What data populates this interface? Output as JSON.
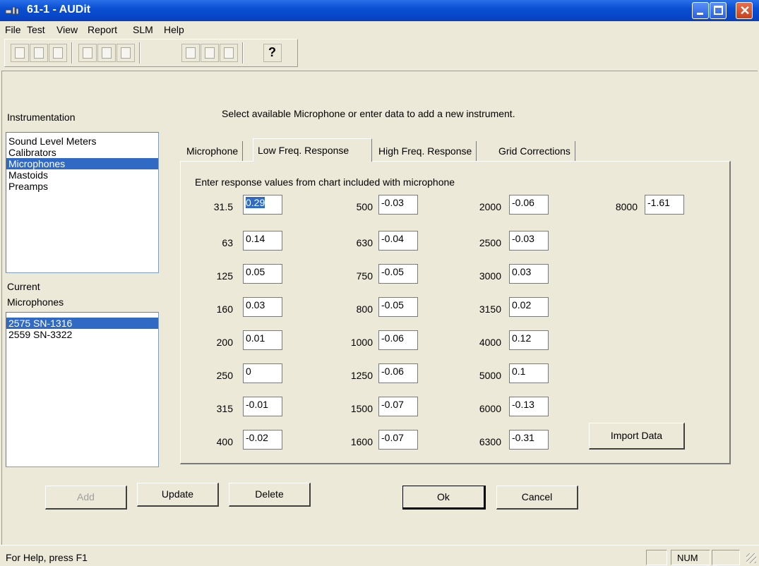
{
  "window": {
    "title": "61-1 - AUDit",
    "close_glyph": "✕"
  },
  "menu": [
    "File",
    "Test",
    "View",
    "Report",
    "SLM",
    "Help"
  ],
  "toolbar": {
    "icons": [
      "new-icon",
      "open-icon",
      "save-icon",
      "sound-level-meter-icon",
      "calibrator-icon",
      "microphone-icon",
      "report-icon",
      "report2-icon",
      "report3-icon",
      "help-icon"
    ],
    "help_glyph": "?"
  },
  "instrumentation": {
    "label": "Instrumentation",
    "items": [
      "Sound Level Meters",
      "Calibrators",
      "Microphones",
      "Mastoids",
      "Preamps"
    ],
    "selected_index": 2
  },
  "current": {
    "label_line1": "Current",
    "label_line2": "Microphones",
    "items": [
      "2575 SN-1316",
      "2559 SN-3322"
    ],
    "selected_index": 0
  },
  "instruction": "Select available Microphone or enter data to add a new instrument.",
  "tabs": [
    "Microphone",
    "Low Freq. Response",
    "High Freq. Response",
    "Grid Corrections"
  ],
  "active_tab": "Low Freq. Response",
  "panel": {
    "hint": "Enter response values from chart included with microphone",
    "columns": [
      [
        {
          "freq": "31.5",
          "value": "0.29"
        },
        {
          "freq": "63",
          "value": "0.14"
        },
        {
          "freq": "125",
          "value": "0.05"
        },
        {
          "freq": "160",
          "value": "0.03"
        },
        {
          "freq": "200",
          "value": "0.01"
        },
        {
          "freq": "250",
          "value": "0"
        },
        {
          "freq": "315",
          "value": "-0.01"
        },
        {
          "freq": "400",
          "value": "-0.02"
        }
      ],
      [
        {
          "freq": "500",
          "value": "-0.03"
        },
        {
          "freq": "630",
          "value": "-0.04"
        },
        {
          "freq": "750",
          "value": "-0.05"
        },
        {
          "freq": "800",
          "value": "-0.05"
        },
        {
          "freq": "1000",
          "value": "-0.06"
        },
        {
          "freq": "1250",
          "value": "-0.06"
        },
        {
          "freq": "1500",
          "value": "-0.07"
        },
        {
          "freq": "1600",
          "value": "-0.07"
        }
      ],
      [
        {
          "freq": "2000",
          "value": "-0.06"
        },
        {
          "freq": "2500",
          "value": "-0.03"
        },
        {
          "freq": "3000",
          "value": "0.03"
        },
        {
          "freq": "3150",
          "value": "0.02"
        },
        {
          "freq": "4000",
          "value": "0.12"
        },
        {
          "freq": "5000",
          "value": "0.1"
        },
        {
          "freq": "6000",
          "value": "-0.13"
        },
        {
          "freq": "6300",
          "value": "-0.31"
        }
      ],
      [
        {
          "freq": "8000",
          "value": "-1.61"
        }
      ]
    ],
    "import_label": "Import Data"
  },
  "buttons": {
    "add": "Add",
    "update": "Update",
    "delete": "Delete",
    "ok": "Ok",
    "cancel": "Cancel"
  },
  "status": {
    "text": "For Help, press F1",
    "num": "NUM"
  },
  "colors": {
    "titlebar": "#0a4fd3",
    "selection": "#316ac5",
    "window_bg": "#ece9d8"
  }
}
